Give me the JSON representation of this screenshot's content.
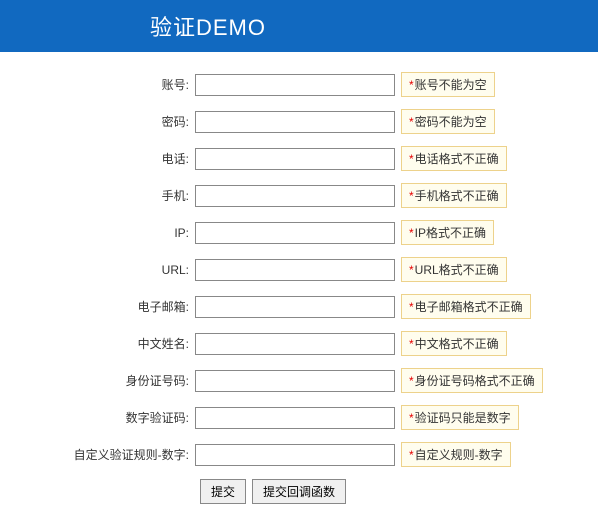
{
  "header": {
    "title": "验证DEMO"
  },
  "form": {
    "fields": [
      {
        "label": "账号:",
        "error": "账号不能为空"
      },
      {
        "label": "密码:",
        "error": "密码不能为空"
      },
      {
        "label": "电话:",
        "error": "电话格式不正确"
      },
      {
        "label": "手机:",
        "error": "手机格式不正确"
      },
      {
        "label": "IP:",
        "error": "IP格式不正确"
      },
      {
        "label": "URL:",
        "error": "URL格式不正确"
      },
      {
        "label": "电子邮箱:",
        "error": "电子邮箱格式不正确"
      },
      {
        "label": "中文姓名:",
        "error": "中文格式不正确"
      },
      {
        "label": "身份证号码:",
        "error": "身份证号码格式不正确"
      },
      {
        "label": "数字验证码:",
        "error": "验证码只能是数字"
      },
      {
        "label": "自定义验证规则-数字:",
        "error": "自定义规则-数字"
      }
    ],
    "buttons": {
      "submit": "提交",
      "submitCallback": "提交回调函数"
    }
  }
}
